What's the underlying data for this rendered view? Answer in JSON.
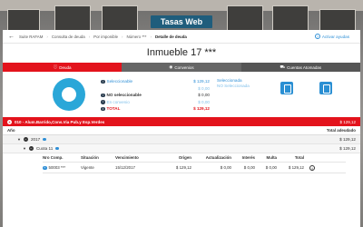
{
  "app": {
    "brand": "Tasas Web"
  },
  "breadcrumb": {
    "items": [
      "Suite RAFAM",
      "Consulta de deuda",
      "Por imponible",
      "Número ***",
      "Detalle de deuda"
    ]
  },
  "help": {
    "label": "Activar ayudas"
  },
  "page": {
    "title": "Inmueble 17 ***"
  },
  "tabs": [
    {
      "label": "Deuda",
      "icon": "info-icon"
    },
    {
      "label": "Convenios",
      "icon": "eye-icon"
    },
    {
      "label": "Cuentas Atomadas",
      "icon": "cart-icon"
    }
  ],
  "summary": {
    "rows": [
      {
        "label": "Seleccionable",
        "value": "$ 129,12",
        "sub": "$ 0,00"
      },
      {
        "label": "NO seleccionable",
        "value": "$ 0,00"
      },
      {
        "label": "En convenio",
        "value": "$ 0,00"
      },
      {
        "label": "TOTAL",
        "value": "$ 129,12"
      }
    ],
    "selected_label": "Seleccionada",
    "not_selected_label": "NO Seleccionada"
  },
  "concept": {
    "label": "010 - Alum.Barrido,Cons.Via Pub.y Esp.Verdes",
    "amount": "$ 129,12"
  },
  "table": {
    "year_header": "Año",
    "total_header": "Total adeudado",
    "year": {
      "label": "2017",
      "amount": "$ 129,12"
    },
    "cuota": {
      "label": "Cuota 11",
      "amount": "$ 129,12"
    },
    "columns": [
      "Nro Comp.",
      "Situación",
      "Vencimiento",
      "Origen",
      "Actualización",
      "Interés",
      "Multa",
      "Total"
    ],
    "rows": [
      {
        "comp": "50003 ***",
        "situacion": "Vigente",
        "vencimiento": "15/12/2017",
        "origen": "$ 129,12",
        "actualizacion": "$ 0,00",
        "interes": "$ 0,00",
        "multa": "$ 0,00",
        "total": "$ 129,12"
      }
    ]
  },
  "colors": {
    "brand": "#1f5d7c",
    "accent_red": "#e3131c",
    "donut": "#2aa7d8",
    "link_blue": "#2f8fd6"
  }
}
